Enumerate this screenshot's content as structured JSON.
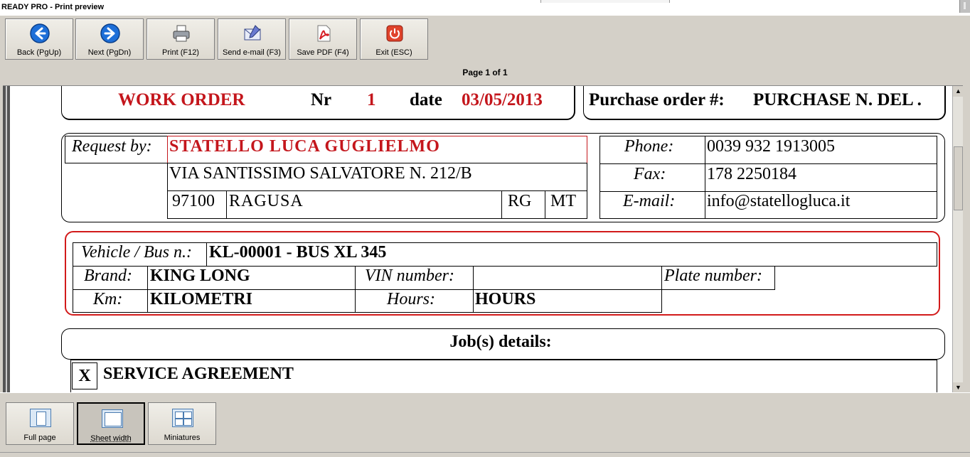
{
  "window": {
    "title": "READY PRO - Print preview"
  },
  "toolbar": {
    "back_label": "Back (PgUp)",
    "next_label": "Next (PgDn)",
    "print_label": "Print (F12)",
    "email_label": "Send e-mail (F3)",
    "pdf_label": "Save PDF (F4)",
    "exit_label": "Exit (ESC)"
  },
  "icons": {
    "back": "arrow-left-icon",
    "next": "arrow-right-icon",
    "print": "printer-icon",
    "email": "envelope-icon",
    "pdf": "pdf-icon",
    "exit": "power-icon"
  },
  "page_info": "Page 1 of 1",
  "document": {
    "header": {
      "title": "WORK ORDER",
      "nr_label": "Nr",
      "nr_value": "1",
      "date_label": "date",
      "date_value": "03/05/2013",
      "po_label": "Purchase order #:",
      "po_value": "PURCHASE N. DEL ."
    },
    "customer": {
      "request_label": "Request by:",
      "name": "STATELLO LUCA GUGLIELMO",
      "address": "VIA SANTISSIMO SALVATORE N. 212/B",
      "zip": "97100",
      "city": "RAGUSA",
      "province": "RG",
      "country": "MT",
      "phone_label": "Phone:",
      "phone": "0039 932 1913005",
      "fax_label": "Fax:",
      "fax": "178 2250184",
      "email_label": "E-mail:",
      "email": "info@statellogluca.it"
    },
    "vehicle": {
      "vehicle_label": "Vehicle / Bus n.:",
      "vehicle_value": "KL-00001 - BUS XL 345",
      "brand_label": "Brand:",
      "brand_value": "KING LONG",
      "vin_label": "VIN number:",
      "vin_value": "",
      "plate_label": "Plate number:",
      "km_label": "Km:",
      "km_value": "KILOMETRI",
      "hours_label": "Hours:",
      "hours_value": "HOURS"
    },
    "jobs": {
      "title": "Job(s) details:",
      "check_mark": "X",
      "first_job": "SERVICE AGREEMENT"
    }
  },
  "views": {
    "full_page": "Full page",
    "sheet_width": "Sheet width",
    "miniatures": "Miniatures"
  },
  "colors": {
    "accent_red": "#c4161c",
    "vehicle_box_border": "#d21a1a"
  }
}
